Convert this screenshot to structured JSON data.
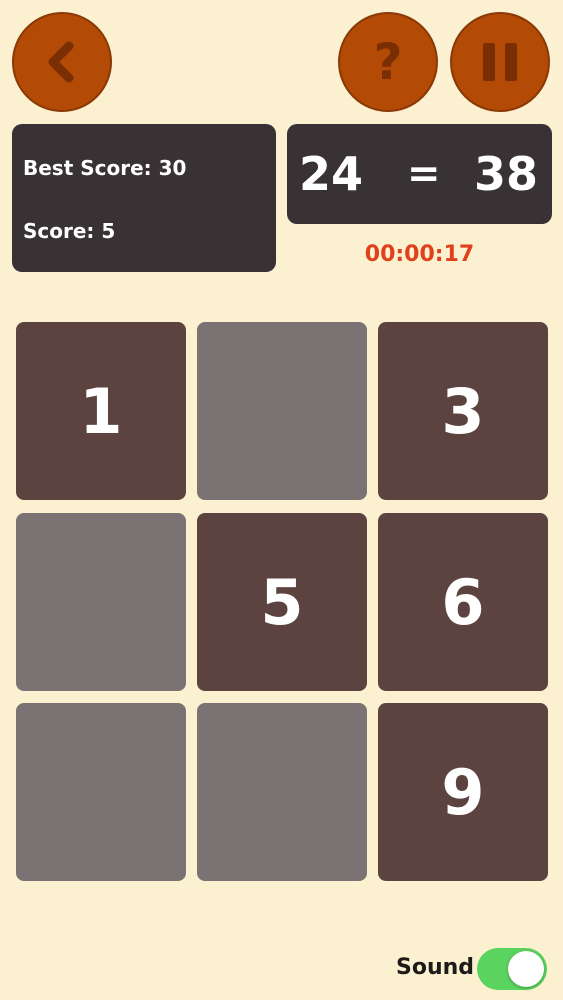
{
  "header": {
    "back_icon": "chevron-left-icon",
    "help_label": "?",
    "pause_icon": "pause-icon"
  },
  "scores": {
    "best_label": "Best Score: 30",
    "score_label": "Score: 5"
  },
  "equation": {
    "left": "24",
    "sign": "=",
    "right": "38"
  },
  "timer": "00:00:17",
  "grid": {
    "tiles": [
      {
        "label": "1",
        "active": true
      },
      {
        "label": "",
        "active": false
      },
      {
        "label": "3",
        "active": true
      },
      {
        "label": "",
        "active": false
      },
      {
        "label": "5",
        "active": true
      },
      {
        "label": "6",
        "active": true
      },
      {
        "label": "",
        "active": false
      },
      {
        "label": "",
        "active": false
      },
      {
        "label": "9",
        "active": true
      }
    ]
  },
  "sound": {
    "label": "Sound",
    "enabled": true
  },
  "colors": {
    "background": "#fbf1d1",
    "button": "#b34a06",
    "panel": "#393234",
    "tile_active": "#5d4340",
    "tile_inactive": "#7b7274",
    "timer": "#e0401c",
    "toggle_on": "#5bd35f"
  }
}
